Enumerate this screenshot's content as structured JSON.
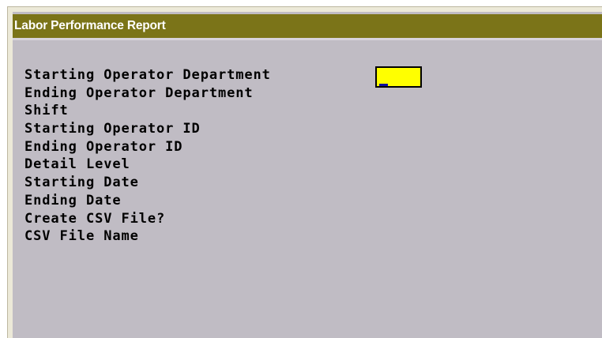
{
  "window": {
    "title": "Labor Performance Report"
  },
  "form": {
    "fields": [
      {
        "label": "Starting Operator Department"
      },
      {
        "label": "Ending Operator Department"
      },
      {
        "label": "Shift"
      },
      {
        "label": "Starting Operator ID"
      },
      {
        "label": "Ending Operator ID"
      },
      {
        "label": "Detail Level"
      },
      {
        "label": "Starting Date"
      },
      {
        "label": "Ending Date"
      },
      {
        "label": "Create CSV File?"
      },
      {
        "label": "CSV File Name"
      }
    ],
    "active_input": {
      "value": "",
      "background": "#ffff00"
    }
  },
  "colors": {
    "titlebar": "#7b7418",
    "body": "#c0bcc4",
    "frame": "#ece9d8"
  }
}
